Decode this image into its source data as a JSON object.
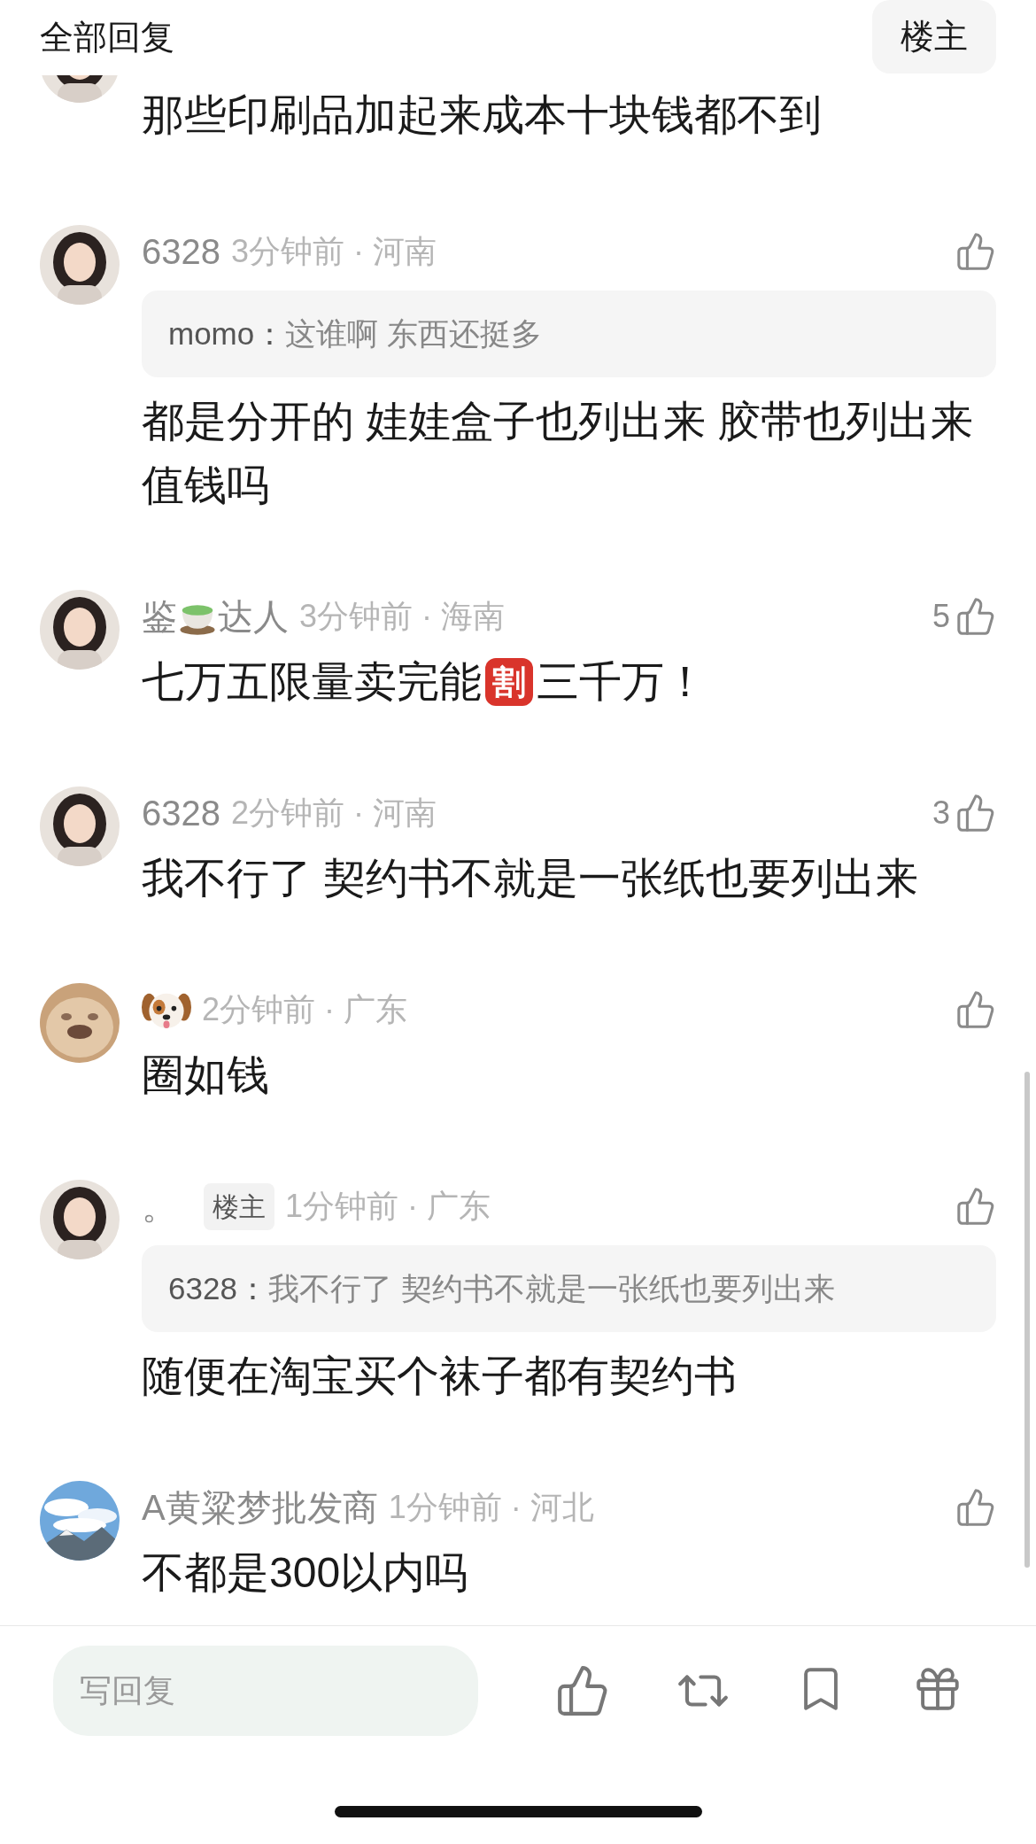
{
  "header": {
    "title": "全部回复",
    "filter_button": "楼主"
  },
  "comments": [
    {
      "content": [
        {
          "kind": "text",
          "text": "那些印刷品加起来成本十块钱都不到"
        }
      ]
    },
    {
      "author": [
        {
          "kind": "text",
          "text": "6328"
        }
      ],
      "meta": "3分钟前 · 河南",
      "quote": {
        "author": "momo：",
        "text": "这谁啊 东西还挺多"
      },
      "content": [
        {
          "kind": "text",
          "text": "都是分开的 娃娃盒子也列出来 胶带也列出来值钱吗"
        }
      ]
    },
    {
      "author": [
        {
          "kind": "text",
          "text": "鉴"
        },
        {
          "kind": "cup-emoji"
        },
        {
          "kind": "text",
          "text": "达人"
        }
      ],
      "meta": "3分钟前 · 海南",
      "likes": "5",
      "content": [
        {
          "kind": "text",
          "text": "七万五限量卖完能"
        },
        {
          "kind": "badge",
          "text": "割"
        },
        {
          "kind": "text",
          "text": "三千万！"
        }
      ]
    },
    {
      "author": [
        {
          "kind": "text",
          "text": "6328"
        }
      ],
      "meta": "2分钟前 · 河南",
      "likes": "3",
      "content": [
        {
          "kind": "text",
          "text": "我不行了 契约书不就是一张纸也要列出来"
        }
      ]
    },
    {
      "author": [
        {
          "kind": "dog-emoji"
        }
      ],
      "meta": "2分钟前 · 广东",
      "content": [
        {
          "kind": "text",
          "text": "圈如钱"
        }
      ]
    },
    {
      "author": [
        {
          "kind": "text",
          "text": "。"
        }
      ],
      "op_badge": "楼主",
      "meta": "1分钟前 · 广东",
      "quote": {
        "author": "6328：",
        "text": "我不行了 契约书不就是一张纸也要列出来"
      },
      "content": [
        {
          "kind": "text",
          "text": "随便在淘宝买个袜子都有契约书"
        }
      ]
    },
    {
      "author": [
        {
          "kind": "text",
          "text": "A黄粱梦批发商"
        }
      ],
      "meta": "1分钟前 · 河北",
      "content": [
        {
          "kind": "text",
          "text": "不都是300以内吗"
        }
      ]
    }
  ],
  "composer": {
    "placeholder": "写回复"
  }
}
